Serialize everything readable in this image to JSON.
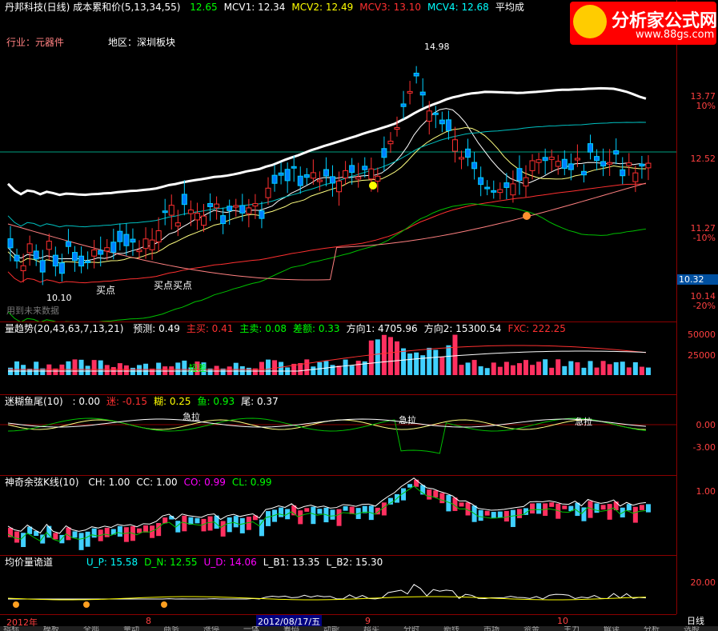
{
  "window": {
    "title": "丹邦科技(日线) 成本累和价(5,13,34,55)",
    "header_values": [
      {
        "label": "",
        "value": "12.65",
        "color": "#00ff00"
      },
      {
        "label": "MCV1:",
        "value": "12.34",
        "color": "#ffffff"
      },
      {
        "label": "MCV2:",
        "value": "12.49",
        "color": "#ffff00"
      },
      {
        "label": "MCV3:",
        "value": "13.10",
        "color": "#ff3030"
      },
      {
        "label": "MCV4:",
        "value": "12.68",
        "color": "#00ffff"
      },
      {
        "label": "平均成",
        "value": "",
        "color": "#ffffff"
      }
    ],
    "industry": "行业：元器件",
    "region": "地区：深圳板块"
  },
  "logo": {
    "text": "分析家公式网",
    "url": "www.88gs.com"
  },
  "main_chart": {
    "high_label": "14.98",
    "low_label": "10.10",
    "signals": [
      "买点",
      "买点买点"
    ],
    "watermark": "用到未来数据",
    "price_ticks": [
      {
        "price": "13.77",
        "pct": "10%"
      },
      {
        "price": "12.52",
        "pct": ""
      },
      {
        "price": "11.27",
        "pct": "-10%"
      },
      {
        "price": "10.14",
        "pct": "-20%"
      }
    ],
    "current_price": "10.32"
  },
  "volume_panel": {
    "header": "量趋势(20,43,63,7,13,21)",
    "items": [
      {
        "label": "预测:",
        "value": "0.49",
        "color": "#ffffff"
      },
      {
        "label": "主买:",
        "value": "0.41",
        "color": "#ff3030"
      },
      {
        "label": "主卖:",
        "value": "0.08",
        "color": "#00ff00"
      },
      {
        "label": "差额:",
        "value": "0.33",
        "color": "#00ff00"
      },
      {
        "label": "方向1:",
        "value": "4705.96",
        "color": "#ffffff"
      },
      {
        "label": "方向2:",
        "value": "15300.54",
        "color": "#ffffff"
      },
      {
        "label": "FXC:",
        "value": "222.25",
        "color": "#ff3030"
      }
    ],
    "ticks": [
      "50000",
      "25000"
    ],
    "tag": "短差"
  },
  "fish_panel": {
    "header": "迷糊鱼尾(10)",
    "items": [
      {
        "label": ":",
        "value": "0.00",
        "color": "#ffffff"
      },
      {
        "label": "迷:",
        "value": "-0.15",
        "color": "#ff3030"
      },
      {
        "label": "糊:",
        "value": "0.25",
        "color": "#ffff00"
      },
      {
        "label": "鱼:",
        "value": "0.93",
        "color": "#00ff00"
      },
      {
        "label": "尾:",
        "value": "0.37",
        "color": "#ffffff"
      }
    ],
    "ticks": [
      "0.00",
      "-3.00"
    ],
    "tag": "急拉"
  },
  "sine_panel": {
    "header": "神奇余弦K线(10)",
    "items": [
      {
        "label": "CH:",
        "value": "1.00",
        "color": "#ffffff"
      },
      {
        "label": "CC:",
        "value": "1.00",
        "color": "#ffffff"
      },
      {
        "label": "CO:",
        "value": "0.99",
        "color": "#ff00ff"
      },
      {
        "label": "CL:",
        "value": "0.99",
        "color": "#00ff00"
      }
    ],
    "ticks": [
      "1.00"
    ]
  },
  "avg_panel": {
    "header": "均价量诡道",
    "items": [
      {
        "label": "U_P:",
        "value": "15.58",
        "color": "#00ffff"
      },
      {
        "label": "D_N:",
        "value": "12.55",
        "color": "#00ff00"
      },
      {
        "label": "U_D:",
        "value": "14.06",
        "color": "#ff00ff"
      },
      {
        "label": "L_B1:",
        "value": "13.35",
        "color": "#ffffff"
      },
      {
        "label": "L_B2:",
        "value": "15.30",
        "color": "#ffffff"
      }
    ],
    "ticks": [
      "20.00"
    ]
  },
  "time_axis": {
    "labels": [
      "2012年",
      "8",
      "9",
      "10"
    ],
    "cursor_date": "2012/08/17/五",
    "period": "日线"
  },
  "bottom_tabs": [
    "指标",
    "模板",
    "全部",
    "量动",
    "商务",
    "涨停",
    "一体",
    "筹码",
    "动能",
    "超买",
    "分时",
    "新线",
    "市场",
    "资金",
    "主力",
    "解读",
    "分析",
    "选股"
  ],
  "colors": {
    "up": "#ff3030",
    "down": "#00d0ff",
    "border": "#8b0000"
  }
}
